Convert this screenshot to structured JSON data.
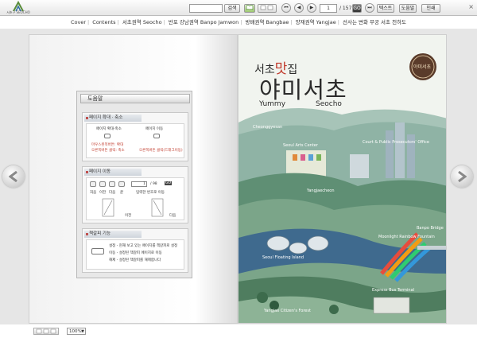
{
  "toolbar": {
    "logo_text": "서초구 SEOCHO",
    "search_placeholder": "",
    "search_label": "검색",
    "page_current": "1",
    "page_total": "/ 157",
    "go_label": "GO",
    "print_label": "인쇄",
    "help_label": "도움말",
    "mode_label": "텍스트",
    "close_glyph": "×"
  },
  "nav": {
    "items": [
      "Cover",
      "Contents",
      "서초권역 Seocho",
      "반포 강남권역 Banpo Jamwon",
      "방배권역 Bangbae",
      "양재권역 Yangjae",
      "선사는 변화 무궁 서초 천하도"
    ]
  },
  "help_panel": {
    "title": "도움말",
    "zoom": {
      "heading": "페이지 확대 · 축소",
      "left_label": "페이지 확대·축소",
      "right_label": "페이지 이동",
      "left_line1": "마우스왼쪽버튼: 확대",
      "left_line2": "오른쪽버튼 클릭: 축소",
      "right_line1": "오른쪽버튼 클릭(드래그이동)"
    },
    "move": {
      "heading": "페이지 이동",
      "page_value": "1",
      "page_total": "/ 98",
      "go_label": "GO",
      "labels": [
        "처음",
        "이전",
        "다음",
        "끝",
        "입력한 번호로 이동"
      ],
      "prev_label": "이전",
      "next_label": "다음"
    },
    "book": {
      "heading": "책갈피 기능",
      "line1": "설정 - 현재 보고 있는 페이지를 책갈피로 설정",
      "line2": "이동 - 설정된 책갈피 페이지로 이동",
      "line3": "해제 - 설정된 책갈피를 해제합니다"
    }
  },
  "cover": {
    "subtitle_pre": "서초",
    "subtitle_accent": "맛",
    "subtitle_post": "집",
    "title": "야미서초",
    "english_left": "Yummy",
    "english_right": "Seocho",
    "seal_text": "야미서초",
    "labels": [
      "Cheonggyesan",
      "Seoul Arts Center",
      "Court & Public Prosecutors' Office",
      "Yangjaecheon",
      "Seoul Floating Island",
      "Banpo Bridge",
      "Moonlight Rainbow Fountain",
      "Express Bus Terminal",
      "Yangjae Citizen's Forest"
    ]
  },
  "bottom": {
    "zoom_value": "100%"
  },
  "colors": {
    "accent_red": "#c0392b",
    "title_dark": "#2b2b2b",
    "green": "#6f9a79",
    "blue": "#3f6a8e"
  }
}
